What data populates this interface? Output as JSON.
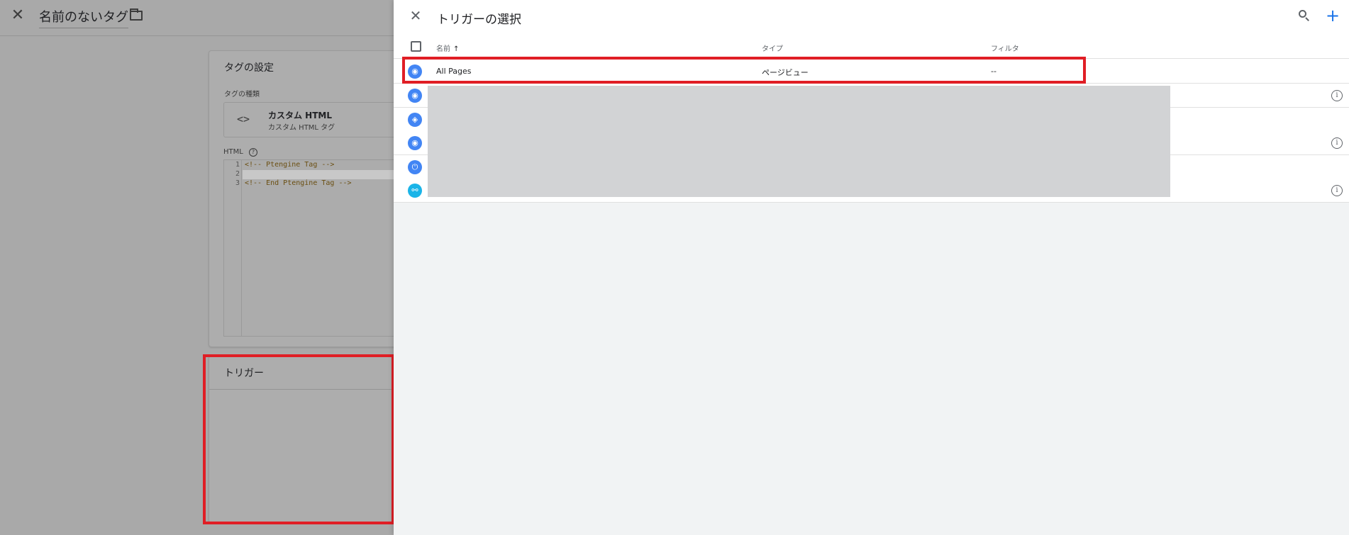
{
  "editor": {
    "title": "名前のないタグ",
    "close_icon": "close-icon",
    "folder_icon": "folder-icon",
    "config_card": {
      "title": "タグの設定",
      "tag_type_label": "タグの種類",
      "tag_type_name": "カスタム HTML",
      "tag_type_desc": "カスタム HTML タグ",
      "code_icon_glyph": "<>",
      "html_label": "HTML",
      "help_glyph": "?",
      "code_lines": [
        {
          "num": "1",
          "text": "<!-- Ptengine Tag -->"
        },
        {
          "num": "2",
          "text": ""
        },
        {
          "num": "3",
          "text": "<!-- End Ptengine Tag -->"
        }
      ]
    },
    "trigger_card": {
      "title": "トリガー"
    }
  },
  "picker": {
    "title": "トリガーの選択",
    "close_glyph": "✕",
    "add_glyph": "+",
    "columns": {
      "name": "名前",
      "sort_glyph": "↑",
      "type": "タイプ",
      "filter": "フィルタ"
    },
    "rows": [
      {
        "icon": "eye-icon",
        "glyph": "◉",
        "name": "All Pages",
        "type": "ページビュー",
        "filter": "--",
        "info": false
      },
      {
        "icon": "eye-icon",
        "glyph": "◉",
        "name": "",
        "type": "",
        "filter": "",
        "info": true
      },
      {
        "icon": "shield-icon",
        "glyph": "◈",
        "name": "",
        "type": "",
        "filter": "",
        "info": false
      },
      {
        "icon": "eye-icon",
        "glyph": "◉",
        "name": "",
        "type": "",
        "filter": "",
        "info": true
      },
      {
        "icon": "power-icon",
        "glyph": "⏻",
        "name": "",
        "type": "",
        "filter": "",
        "info": false
      },
      {
        "icon": "link-icon",
        "glyph": "⚯",
        "name": "",
        "type": "",
        "filter": "",
        "info": true
      }
    ],
    "info_glyph": "i"
  },
  "colors": {
    "accent": "#1a73e8",
    "highlight": "#e01e25",
    "trigger_icon": "#4285f4",
    "link_icon": "#1ab4e8"
  }
}
